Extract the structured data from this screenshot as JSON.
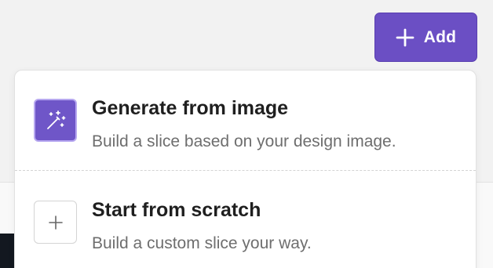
{
  "header": {
    "add_button": {
      "label": "Add",
      "icon": "plus-icon"
    }
  },
  "menu": {
    "items": [
      {
        "title": "Generate from image",
        "description": "Build a slice based on your design image.",
        "icon": "magic-wand-icon"
      },
      {
        "title": "Start from scratch",
        "description": "Build a custom slice your way.",
        "icon": "plus-icon"
      }
    ]
  },
  "colors": {
    "accent": "#6b4fc4",
    "accent_border": "#b7a8f0",
    "title_text": "#1f1f1f",
    "description_text": "#6e6e6e",
    "background": "#f2f2f2"
  }
}
